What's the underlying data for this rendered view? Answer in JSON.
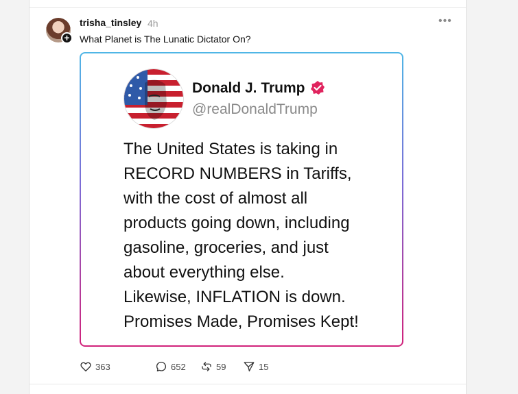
{
  "post": {
    "username": "trisha_tinsley",
    "time": "4h",
    "more_label": "•••",
    "text": "What Planet is The Lunatic Dictator On?"
  },
  "embedded_tweet": {
    "name": "Donald J. Trump",
    "handle": "@realDonaldTrump",
    "body": "The United States is taking in\nRECORD NUMBERS in Tariffs,\nwith the cost of almost all\nproducts going down, including\ngasoline, groceries, and just\nabout everything else.\nLikewise, INFLATION is down.\nPromises Made, Promises Kept!"
  },
  "actions": {
    "likes": "363",
    "replies": "652",
    "reposts": "59",
    "shares": "15"
  },
  "colors": {
    "verified": "#e0245e",
    "gradient_top": "#4fb6e6",
    "gradient_bottom": "#d1217a"
  },
  "icons": [
    "heart-icon",
    "comment-icon",
    "repost-icon",
    "share-icon",
    "plus-icon",
    "verified-badge-icon"
  ]
}
